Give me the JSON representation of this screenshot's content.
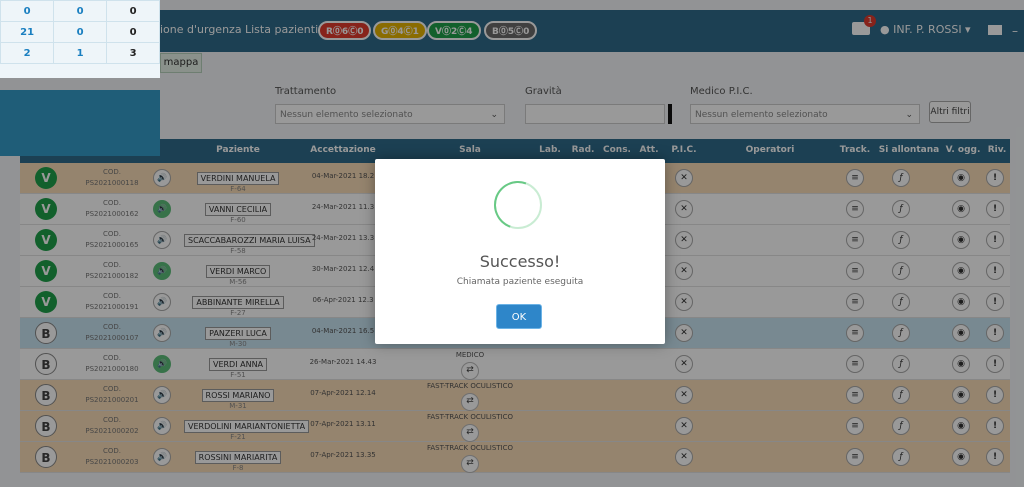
{
  "summary": {
    "rows": [
      [
        "0",
        "0",
        "0"
      ],
      [
        "21",
        "0",
        "0"
      ],
      [
        "2",
        "1",
        "3"
      ]
    ],
    "colors": {
      "col1": "#1a7fc0",
      "col2": "#1a7fc0",
      "col3": "#222222"
    }
  },
  "navbar": {
    "link_urgenza": "ione d'urgenza",
    "link_lista": "Lista pazienti",
    "pills": [
      {
        "label": "R⓪6Ⓒ0",
        "color": "#e23b2e"
      },
      {
        "label": "G⓪4Ⓒ1",
        "color": "#e6b400"
      },
      {
        "label": "V⓪2Ⓒ4",
        "color": "#1fa14a"
      },
      {
        "label": "B⓪5Ⓒ0",
        "color": "#6b6b6b"
      }
    ],
    "ambulance_count": "1",
    "user": "INF. P. ROSSI",
    "dash": "–"
  },
  "tab_mappa": "mappa",
  "filters": {
    "trattamento_label": "Trattamento",
    "trattamento_value": "Nessun elemento selezionato",
    "gravita_label": "Gravità",
    "medico_label": "Medico P.I.C.",
    "medico_value": "Nessun elemento selezionato",
    "altri_filtri": "Altri filtri"
  },
  "table": {
    "headers": [
      "Paziente",
      "Accettazione",
      "Sala",
      "Lab.",
      "Rad.",
      "Cons.",
      "Att.",
      "P.I.C.",
      "Operatori",
      "Track.",
      "Si allontana",
      "V. ogg.",
      "Riv."
    ],
    "rows": [
      {
        "code": "V",
        "cod_label": "COD.",
        "id": "PS2021000118",
        "name": "VERDINI MANUELA",
        "info": "F-64",
        "acc": "04-Mar-2021 18.2",
        "sala": "",
        "color": "orange",
        "sound": "plain"
      },
      {
        "code": "V",
        "cod_label": "COD.",
        "id": "PS2021000162",
        "name": "VANNI CECILIA",
        "info": "F-60",
        "acc": "24-Mar-2021 11.3",
        "sala": "",
        "color": "white",
        "sound": "green"
      },
      {
        "code": "V",
        "cod_label": "COD.",
        "id": "PS2021000165",
        "name": "SCACCABAROZZI MARIA LUISA",
        "info": "F-58",
        "acc": "24-Mar-2021 13.3",
        "sala": "",
        "color": "white",
        "sound": "plain"
      },
      {
        "code": "V",
        "cod_label": "COD.",
        "id": "PS2021000182",
        "name": "VERDI MARCO",
        "info": "M-56",
        "acc": "30-Mar-2021 12.4",
        "sala": "",
        "color": "white",
        "sound": "green"
      },
      {
        "code": "V",
        "cod_label": "COD.",
        "id": "PS2021000191",
        "name": "ABBINANTE MIRELLA",
        "info": "F-27",
        "acc": "06-Apr-2021 12.3",
        "sala": "",
        "color": "white",
        "sound": "plain"
      },
      {
        "code": "B",
        "cod_label": "COD.",
        "id": "PS2021000107",
        "name": "PANZERI LUCA",
        "info": "M-30",
        "acc": "04-Mar-2021 16.5",
        "sala": "",
        "color": "blue",
        "sound": "plain"
      },
      {
        "code": "B",
        "cod_label": "COD.",
        "id": "PS2021000180",
        "name": "VERDI ANNA",
        "info": "F-51",
        "acc": "26-Mar-2021 14.43",
        "sala": "MEDICO",
        "color": "white",
        "sound": "green"
      },
      {
        "code": "B",
        "cod_label": "COD.",
        "id": "PS2021000201",
        "name": "ROSSI MARIANO",
        "info": "M-31",
        "acc": "07-Apr-2021 12.14",
        "sala": "FAST-TRACK OCULISTICO",
        "color": "orange",
        "sound": "plain"
      },
      {
        "code": "B",
        "cod_label": "COD.",
        "id": "PS2021000202",
        "name": "VERDOLINI MARIANTONIETTA",
        "info": "F-21",
        "acc": "07-Apr-2021 13.11",
        "sala": "FAST-TRACK OCULISTICO",
        "color": "orange",
        "sound": "plain"
      },
      {
        "code": "B",
        "cod_label": "COD.",
        "id": "PS2021000203",
        "name": "ROSSINI MARIARITA",
        "info": "F-8",
        "acc": "07-Apr-2021 13.35",
        "sala": "FAST-TRACK OCULISTICO",
        "color": "orange",
        "sound": "plain"
      }
    ]
  },
  "modal": {
    "title": "Successo!",
    "message": "Chiamata paziente eseguita",
    "ok_label": "OK"
  }
}
